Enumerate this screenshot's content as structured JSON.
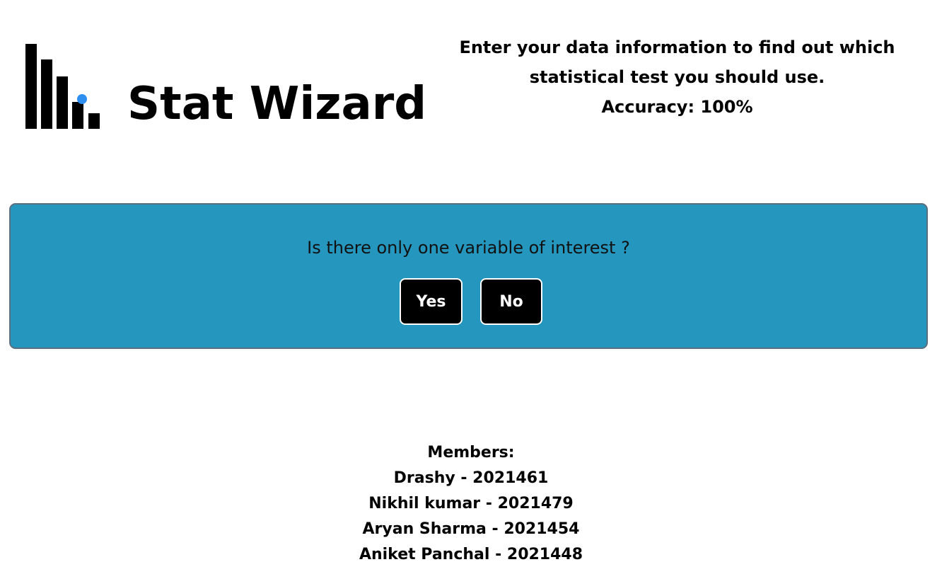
{
  "header": {
    "brand": "Stat Wizard",
    "logo_icon": "bar-chart-icon",
    "intro_line1": "Enter your data information to find out which",
    "intro_line2": "statistical test you should use.",
    "accuracy": "Accuracy: 100%"
  },
  "question_panel": {
    "question": "Is there only one variable of interest ?",
    "yes_label": "Yes",
    "no_label": "No",
    "background_color": "#2596be"
  },
  "members": {
    "heading": "Members:",
    "list": [
      "Drashy - 2021461",
      "Nikhil kumar - 2021479",
      "Aryan Sharma - 2021454",
      "Aniket Panchal - 2021448"
    ]
  }
}
